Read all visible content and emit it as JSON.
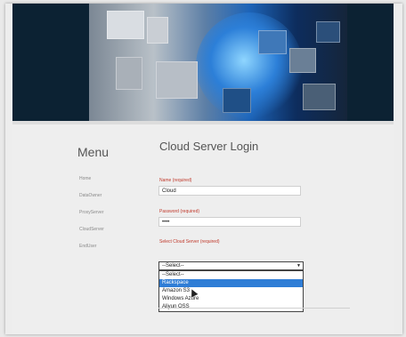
{
  "menu": {
    "title": "Menu",
    "items": [
      "Home",
      "DataOwner",
      "ProxyServer",
      "CloudServer",
      "EndUser"
    ]
  },
  "login": {
    "title": "Cloud Server Login",
    "name_label": "Name (required)",
    "name_value": "Cloud",
    "password_label": "Password (required)",
    "password_value": "••••",
    "server_label": "Select Cloud Server (required)",
    "server_selected": "--Select--",
    "server_options": [
      "--Select--",
      "Rackspace",
      "Amazon S3",
      "Windows Azure",
      "Aliyun OSS"
    ],
    "highlighted_option": "Rackspace"
  },
  "colors": {
    "header_bg": "#0c2233",
    "required_label": "#c0392b",
    "selected_option": "#2f7dd6"
  }
}
